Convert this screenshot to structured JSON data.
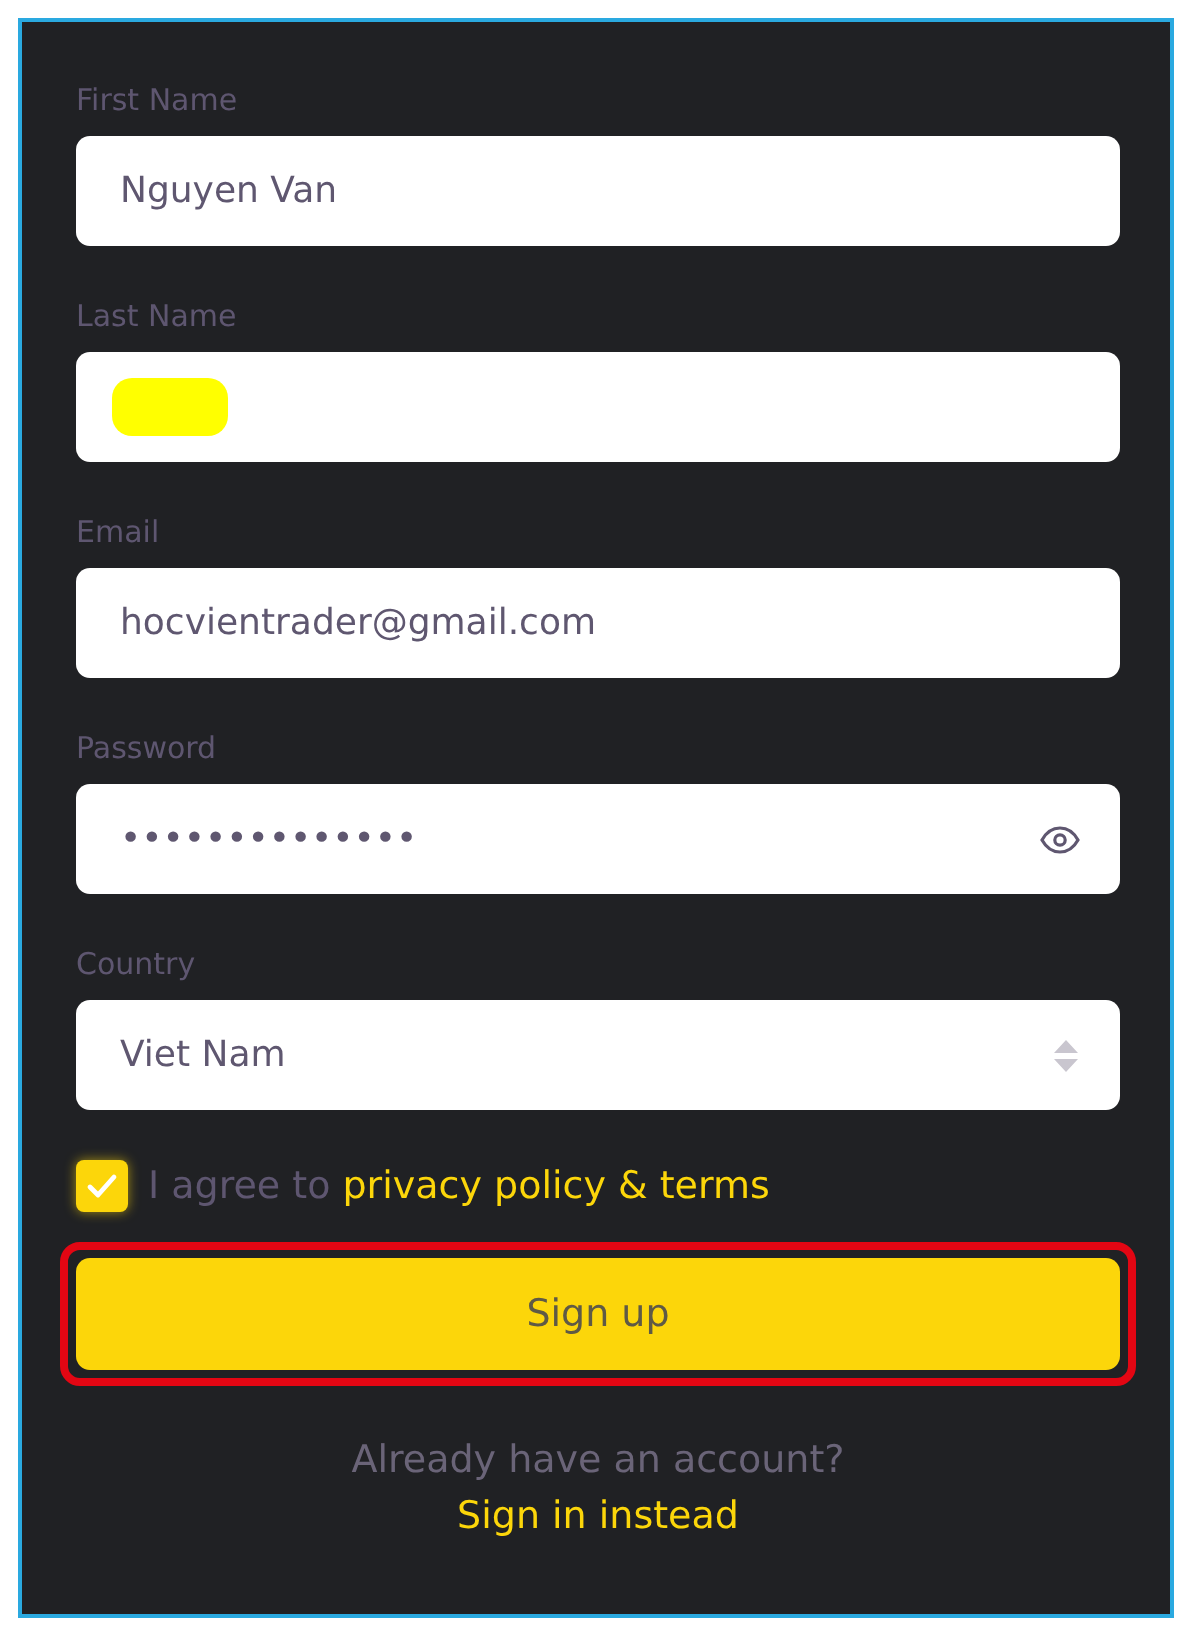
{
  "fields": [
    {
      "kind": "text",
      "label": "First Name",
      "value": "Nguyen Van"
    },
    {
      "kind": "redacted",
      "label": "Last Name"
    },
    {
      "kind": "text",
      "label": "Email",
      "value": "hocvientrader@gmail.com"
    },
    {
      "kind": "password",
      "label": "Password",
      "value": "••••••••••••••"
    },
    {
      "kind": "select",
      "label": "Country",
      "value": "Viet Nam"
    }
  ],
  "agree": {
    "checked": true,
    "text": "I agree to",
    "link": "privacy policy & terms"
  },
  "submit": {
    "label": "Sign up",
    "highlighted": true
  },
  "footer": {
    "question": "Already have an account?",
    "link": "Sign in instead"
  }
}
